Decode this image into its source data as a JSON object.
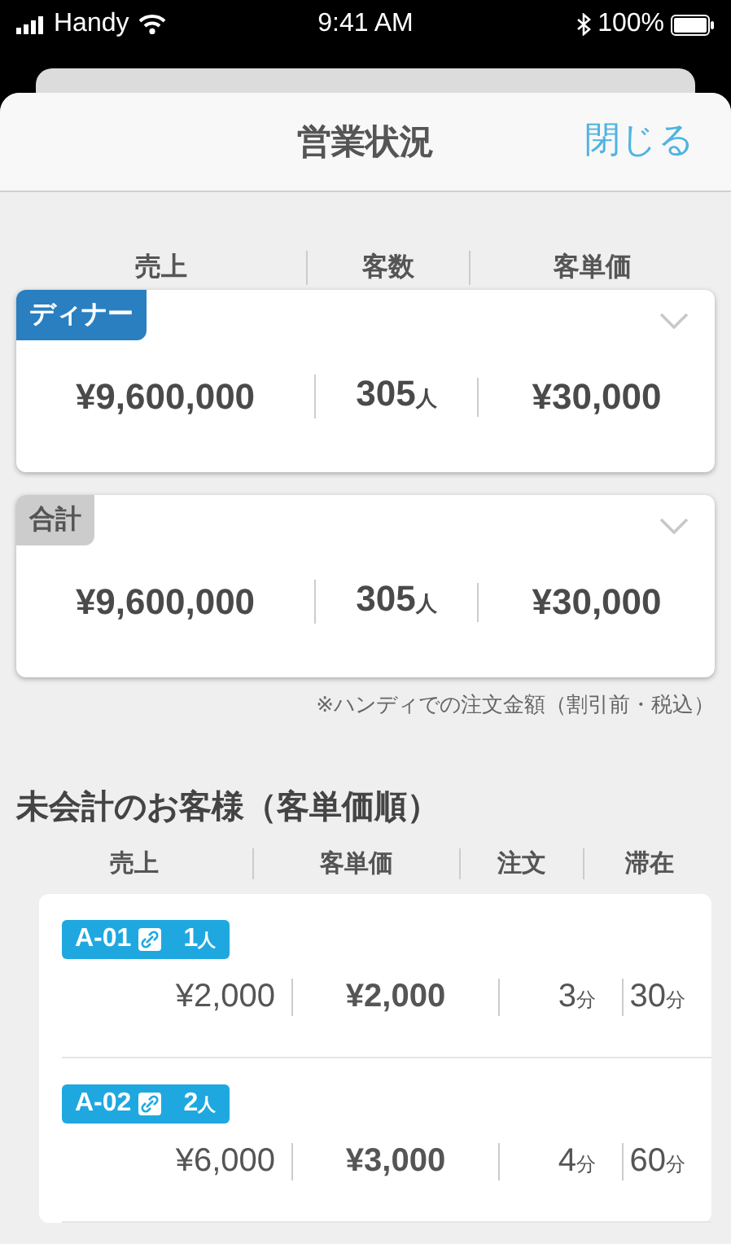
{
  "status_bar": {
    "carrier": "Handy",
    "time": "9:41 AM",
    "battery": "100%"
  },
  "header": {
    "title": "営業状況",
    "close": "閉じる"
  },
  "summary_columns": [
    "売上",
    "客数",
    "客単価"
  ],
  "summary_cards": [
    {
      "label": "ディナー",
      "color": "#2a7fc0",
      "sales": "¥9,600,000",
      "count": "305",
      "count_unit": "人",
      "per_guest": "¥30,000"
    },
    {
      "label": "合計",
      "color": "#cccccc",
      "sales": "¥9,600,000",
      "count": "305",
      "count_unit": "人",
      "per_guest": "¥30,000"
    }
  ],
  "note": "※ハンディでの注文金額（割引前・税込）",
  "unpaid": {
    "title": "未会計のお客様（客単価順）",
    "columns": [
      "売上",
      "客単価",
      "注文",
      "滞在"
    ],
    "rows": [
      {
        "table": "A-01",
        "people": "1",
        "people_unit": "人",
        "sales": "¥2,000",
        "per_guest": "¥2,000",
        "orders": "3",
        "orders_unit": "分",
        "stay": "30",
        "stay_unit": "分"
      },
      {
        "table": "A-02",
        "people": "2",
        "people_unit": "人",
        "sales": "¥6,000",
        "per_guest": "¥3,000",
        "orders": "4",
        "orders_unit": "分",
        "stay": "60",
        "stay_unit": "分"
      }
    ]
  }
}
